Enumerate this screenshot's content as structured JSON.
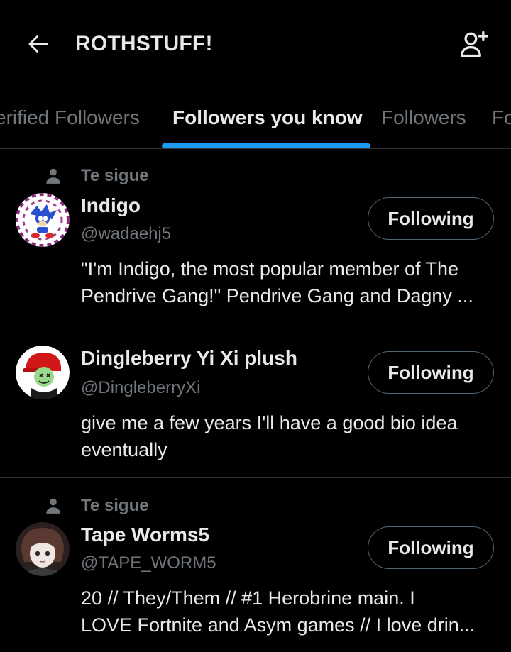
{
  "header": {
    "title": "ROTHSTUFF!",
    "back_icon": "arrow-left-icon",
    "add_user_icon": "person-plus-icon"
  },
  "tabs": [
    {
      "label": "Verified Followers",
      "visible_text": "erified Followers",
      "active": false
    },
    {
      "label": "Followers you know",
      "active": true
    },
    {
      "label": "Followers",
      "active": false
    },
    {
      "label": "Following",
      "visible_text": "Fo",
      "active": false
    }
  ],
  "colors": {
    "background": "#000000",
    "text_primary": "#e7e9ea",
    "text_secondary": "#71767b",
    "accent": "#1d9bf0",
    "divider": "#2f3336",
    "button_border": "#536471"
  },
  "users": [
    {
      "social_context": "Te sigue",
      "name": "Indigo",
      "handle": "@wadaehj5",
      "bio": "\"I'm Indigo, the most popular member of The Pendrive Gang!\" Pendrive Gang and Dagny ...",
      "bio_line1": "\"I'm Indigo, the most popular member of The",
      "bio_line2": "Pendrive Gang!\" Pendrive Gang and Dagny ...",
      "button_label": "Following"
    },
    {
      "social_context": "",
      "name": "Dingleberry Yi Xi plush",
      "handle": "@DingleberryXi",
      "bio": "give me a few years I'll have a good bio idea eventually",
      "bio_line1": "give me a few years I'll have a good bio idea",
      "bio_line2": "eventually",
      "button_label": "Following"
    },
    {
      "social_context": "Te sigue",
      "name": "Tape Worms5",
      "handle": "@TAPE_WORM5",
      "bio": "20 // They/Them // #1 Herobrine main. I LOVE Fortnite and Asym games // I love drin...",
      "bio_line1": "20 // They/Them // #1 Herobrine main. I",
      "bio_line2": "LOVE Fortnite and Asym games // I love drin...",
      "button_label": "Following"
    }
  ]
}
